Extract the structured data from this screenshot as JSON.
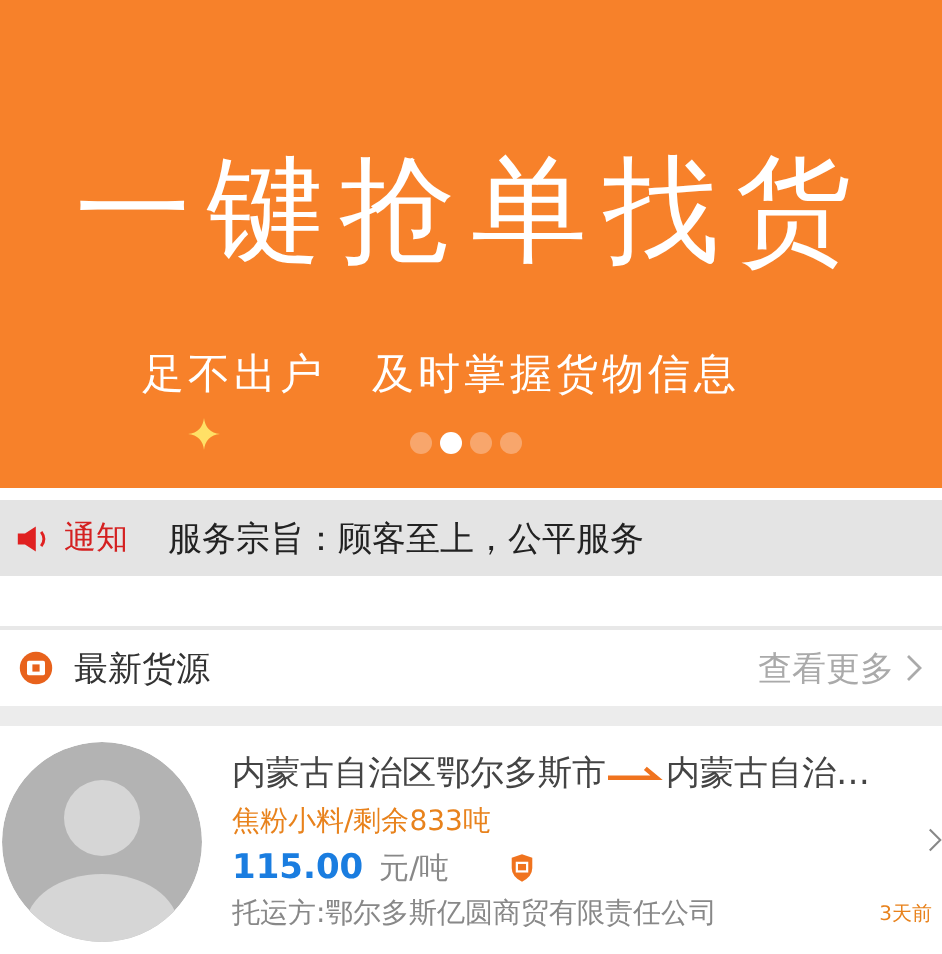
{
  "banner": {
    "headline": "一键抢单找货",
    "subline": "足不出户　及时掌握货物信息",
    "dots": [
      {
        "selected": false
      },
      {
        "selected": true
      },
      {
        "selected": false
      },
      {
        "selected": false
      }
    ]
  },
  "notice": {
    "label": "通知",
    "text": "服务宗旨：顾客至上，公平服务"
  },
  "section": {
    "title": "最新货源",
    "more": "查看更多"
  },
  "listings": [
    {
      "origin": "内蒙古自治区鄂尔多斯市",
      "destination": "内蒙古自治…",
      "cargo": "焦粉小料/剩余833吨",
      "price": "115.00",
      "unit": "元/吨",
      "shipper": "托运方:鄂尔多斯亿圆商贸有限责任公司",
      "time": "3天前"
    }
  ]
}
